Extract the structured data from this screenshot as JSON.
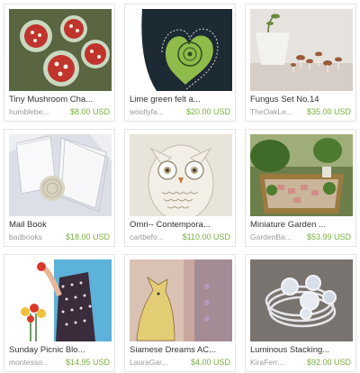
{
  "items": [
    {
      "title": "Tiny Mushroom Cha...",
      "seller": "humblebe...",
      "price": "$8.00 USD"
    },
    {
      "title": "Lime green felt a...",
      "seller": "woollyfa...",
      "price": "$20.00 USD"
    },
    {
      "title": "Fungus Set No.14",
      "seller": "TheOakLe...",
      "price": "$35.00 USD"
    },
    {
      "title": "Mail Book",
      "seller": "badbooks",
      "price": "$18.00 USD"
    },
    {
      "title": "Omri-- Contempora...",
      "seller": "cartbefo...",
      "price": "$110.00 USD"
    },
    {
      "title": "Miniature Garden ...",
      "seller": "GardenBa...",
      "price": "$53.99 USD"
    },
    {
      "title": "Sunday Picnic Blo...",
      "seller": "montesso...",
      "price": "$14.95 USD"
    },
    {
      "title": "Siamese Dreams AC...",
      "seller": "LauraGar...",
      "price": "$4.00 USD"
    },
    {
      "title": "Luminous Stacking...",
      "seller": "KiraFerr...",
      "price": "$92.00 USD"
    }
  ]
}
